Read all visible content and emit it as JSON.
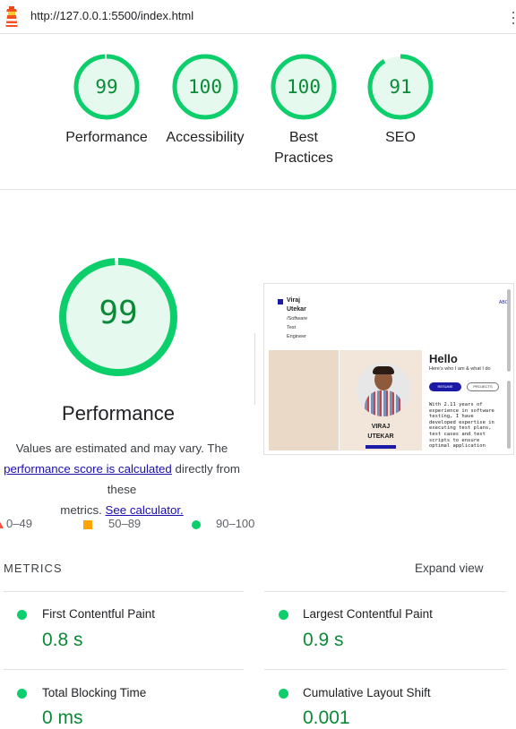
{
  "browser": {
    "url": "http://127.0.0.1:5500/index.html"
  },
  "gauges": [
    {
      "score": "99",
      "label_lines": [
        "Performance"
      ],
      "fraction": 0.99
    },
    {
      "score": "100",
      "label_lines": [
        "Accessibility"
      ],
      "fraction": 1.0
    },
    {
      "score": "100",
      "label_lines": [
        "Best",
        "Practices"
      ],
      "fraction": 1.0
    },
    {
      "score": "91",
      "label_lines": [
        "SEO"
      ],
      "fraction": 0.91
    }
  ],
  "performance": {
    "score": "99",
    "fraction": 0.99,
    "title": "Performance",
    "desc_line1": "Values are estimated and may vary. The",
    "desc_link1": "performance score is calculated",
    "desc_mid": " directly from these",
    "desc_line3a": "metrics. ",
    "desc_link2": "See calculator."
  },
  "legend": {
    "fail": "0–49",
    "average": "50–89",
    "pass": "90–100"
  },
  "screenshot": {
    "name_line1": "Viraj",
    "name_line2": "Utekar",
    "role1": "/Software",
    "role2": "Test",
    "role3": "Engineer",
    "corner_text": "ABO",
    "hello": "Hello",
    "subtitle": "Here's who I am & what I do",
    "btn_resume": "RESUME",
    "btn_projects": "PROJECTS",
    "photo_name1": "VIRAJ",
    "photo_name2": "UTEKAR",
    "bio": [
      "With 2.11 years of",
      "experience in software",
      "testing, I have",
      "developed expertise in",
      "executing test plans,",
      "test cases and test",
      "scripts to ensure",
      "optimal application"
    ]
  },
  "metrics": {
    "heading": "METRICS",
    "expand": "Expand view",
    "items": [
      {
        "name": "First Contentful Paint",
        "value": "0.8 s"
      },
      {
        "name": "Largest Contentful Paint",
        "value": "0.9 s"
      },
      {
        "name": "Total Blocking Time",
        "value": "0 ms"
      },
      {
        "name": "Cumulative Layout Shift",
        "value": "0.001"
      }
    ]
  },
  "colors": {
    "pass": "#0cce6b",
    "pass_text": "#0a8a36",
    "pass_bg": "#e6f9ee",
    "average": "#ffa400",
    "fail": "#ff4e42",
    "link": "#1a0dab"
  }
}
